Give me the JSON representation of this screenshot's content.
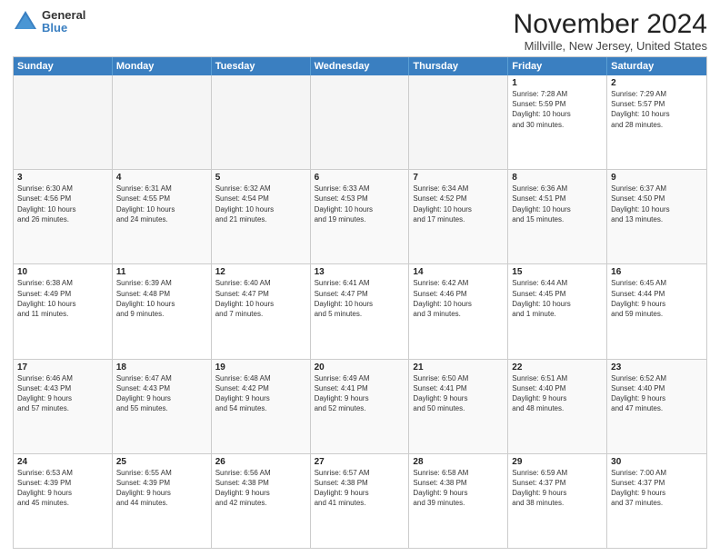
{
  "header": {
    "logo": {
      "general": "General",
      "blue": "Blue"
    },
    "title": "November 2024",
    "subtitle": "Millville, New Jersey, United States"
  },
  "calendar": {
    "days": [
      "Sunday",
      "Monday",
      "Tuesday",
      "Wednesday",
      "Thursday",
      "Friday",
      "Saturday"
    ],
    "rows": [
      [
        {
          "day": "",
          "empty": true
        },
        {
          "day": "",
          "empty": true
        },
        {
          "day": "",
          "empty": true
        },
        {
          "day": "",
          "empty": true
        },
        {
          "day": "",
          "empty": true
        },
        {
          "day": "1",
          "info": "Sunrise: 7:28 AM\nSunset: 5:59 PM\nDaylight: 10 hours\nand 30 minutes."
        },
        {
          "day": "2",
          "info": "Sunrise: 7:29 AM\nSunset: 5:57 PM\nDaylight: 10 hours\nand 28 minutes."
        }
      ],
      [
        {
          "day": "3",
          "info": "Sunrise: 6:30 AM\nSunset: 4:56 PM\nDaylight: 10 hours\nand 26 minutes."
        },
        {
          "day": "4",
          "info": "Sunrise: 6:31 AM\nSunset: 4:55 PM\nDaylight: 10 hours\nand 24 minutes."
        },
        {
          "day": "5",
          "info": "Sunrise: 6:32 AM\nSunset: 4:54 PM\nDaylight: 10 hours\nand 21 minutes."
        },
        {
          "day": "6",
          "info": "Sunrise: 6:33 AM\nSunset: 4:53 PM\nDaylight: 10 hours\nand 19 minutes."
        },
        {
          "day": "7",
          "info": "Sunrise: 6:34 AM\nSunset: 4:52 PM\nDaylight: 10 hours\nand 17 minutes."
        },
        {
          "day": "8",
          "info": "Sunrise: 6:36 AM\nSunset: 4:51 PM\nDaylight: 10 hours\nand 15 minutes."
        },
        {
          "day": "9",
          "info": "Sunrise: 6:37 AM\nSunset: 4:50 PM\nDaylight: 10 hours\nand 13 minutes."
        }
      ],
      [
        {
          "day": "10",
          "info": "Sunrise: 6:38 AM\nSunset: 4:49 PM\nDaylight: 10 hours\nand 11 minutes."
        },
        {
          "day": "11",
          "info": "Sunrise: 6:39 AM\nSunset: 4:48 PM\nDaylight: 10 hours\nand 9 minutes."
        },
        {
          "day": "12",
          "info": "Sunrise: 6:40 AM\nSunset: 4:47 PM\nDaylight: 10 hours\nand 7 minutes."
        },
        {
          "day": "13",
          "info": "Sunrise: 6:41 AM\nSunset: 4:47 PM\nDaylight: 10 hours\nand 5 minutes."
        },
        {
          "day": "14",
          "info": "Sunrise: 6:42 AM\nSunset: 4:46 PM\nDaylight: 10 hours\nand 3 minutes."
        },
        {
          "day": "15",
          "info": "Sunrise: 6:44 AM\nSunset: 4:45 PM\nDaylight: 10 hours\nand 1 minute."
        },
        {
          "day": "16",
          "info": "Sunrise: 6:45 AM\nSunset: 4:44 PM\nDaylight: 9 hours\nand 59 minutes."
        }
      ],
      [
        {
          "day": "17",
          "info": "Sunrise: 6:46 AM\nSunset: 4:43 PM\nDaylight: 9 hours\nand 57 minutes."
        },
        {
          "day": "18",
          "info": "Sunrise: 6:47 AM\nSunset: 4:43 PM\nDaylight: 9 hours\nand 55 minutes."
        },
        {
          "day": "19",
          "info": "Sunrise: 6:48 AM\nSunset: 4:42 PM\nDaylight: 9 hours\nand 54 minutes."
        },
        {
          "day": "20",
          "info": "Sunrise: 6:49 AM\nSunset: 4:41 PM\nDaylight: 9 hours\nand 52 minutes."
        },
        {
          "day": "21",
          "info": "Sunrise: 6:50 AM\nSunset: 4:41 PM\nDaylight: 9 hours\nand 50 minutes."
        },
        {
          "day": "22",
          "info": "Sunrise: 6:51 AM\nSunset: 4:40 PM\nDaylight: 9 hours\nand 48 minutes."
        },
        {
          "day": "23",
          "info": "Sunrise: 6:52 AM\nSunset: 4:40 PM\nDaylight: 9 hours\nand 47 minutes."
        }
      ],
      [
        {
          "day": "24",
          "info": "Sunrise: 6:53 AM\nSunset: 4:39 PM\nDaylight: 9 hours\nand 45 minutes."
        },
        {
          "day": "25",
          "info": "Sunrise: 6:55 AM\nSunset: 4:39 PM\nDaylight: 9 hours\nand 44 minutes."
        },
        {
          "day": "26",
          "info": "Sunrise: 6:56 AM\nSunset: 4:38 PM\nDaylight: 9 hours\nand 42 minutes."
        },
        {
          "day": "27",
          "info": "Sunrise: 6:57 AM\nSunset: 4:38 PM\nDaylight: 9 hours\nand 41 minutes."
        },
        {
          "day": "28",
          "info": "Sunrise: 6:58 AM\nSunset: 4:38 PM\nDaylight: 9 hours\nand 39 minutes."
        },
        {
          "day": "29",
          "info": "Sunrise: 6:59 AM\nSunset: 4:37 PM\nDaylight: 9 hours\nand 38 minutes."
        },
        {
          "day": "30",
          "info": "Sunrise: 7:00 AM\nSunset: 4:37 PM\nDaylight: 9 hours\nand 37 minutes."
        }
      ]
    ]
  }
}
